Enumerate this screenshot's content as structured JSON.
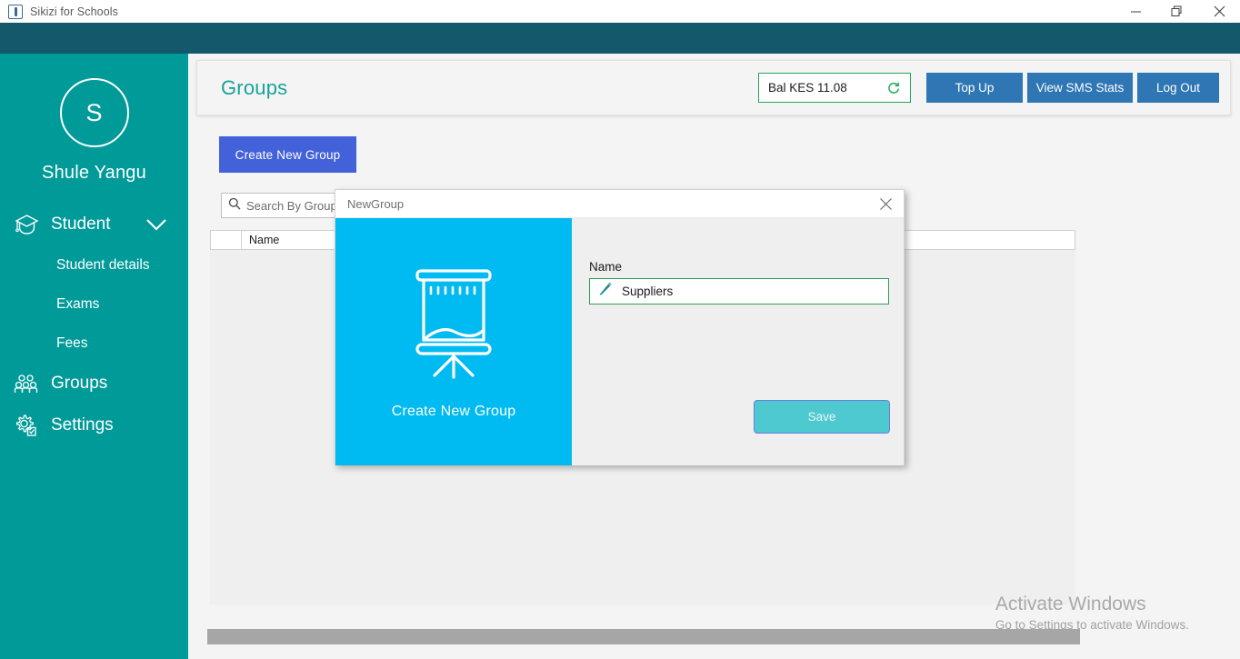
{
  "window": {
    "title": "Sikizi for Schools",
    "app_icon": "app-icon",
    "minimize": "minimize-icon",
    "restore": "restore-icon",
    "close": "close-icon"
  },
  "sidebar": {
    "avatar_initial": "S",
    "user_name": "Shule Yangu",
    "items": [
      {
        "label": "Student",
        "icon": "graduation-cap-icon",
        "expanded": true,
        "chevron": "chevron-down-icon"
      },
      {
        "label": "Student details",
        "icon": "",
        "sub": true
      },
      {
        "label": "Exams",
        "icon": "",
        "sub": true
      },
      {
        "label": "Fees",
        "icon": "",
        "sub": true
      },
      {
        "label": "Groups",
        "icon": "people-group-icon",
        "sub": false
      },
      {
        "label": "Settings",
        "icon": "gear-icon",
        "sub": false
      }
    ]
  },
  "header": {
    "page_title": "Groups",
    "balance_text": "Bal KES 11.08",
    "refresh_icon": "refresh-icon",
    "buttons": [
      {
        "label": "Top Up"
      },
      {
        "label": "View SMS Stats"
      },
      {
        "label": "Log Out"
      }
    ]
  },
  "main": {
    "create_button": "Create New Group",
    "search": {
      "placeholder": "Search By Group Name",
      "value": "",
      "icon": "search-icon"
    },
    "table": {
      "columns": [
        "",
        "Name"
      ],
      "rows": []
    }
  },
  "dialog": {
    "title": "NewGroup",
    "close_icon": "close-icon",
    "panel_icon": "flipchart-easel-icon",
    "panel_caption": "Create New Group",
    "name_label": "Name",
    "name_value": "Suppliers",
    "name_icon": "pencil-icon",
    "save_label": "Save"
  },
  "watermark": {
    "title": "Activate Windows",
    "subtitle": "Go to Settings to activate Windows."
  },
  "colors": {
    "titlebar_band": "#14596b",
    "sidebar": "#009a99",
    "page_title": "#16a39c",
    "header_button": "#2e76b4",
    "create_button": "#4361d9",
    "dialog_panel": "#00baf2",
    "save_button": "#4ec9cf",
    "balance_border": "#25a55a",
    "input_border": "#2f9e4f"
  }
}
